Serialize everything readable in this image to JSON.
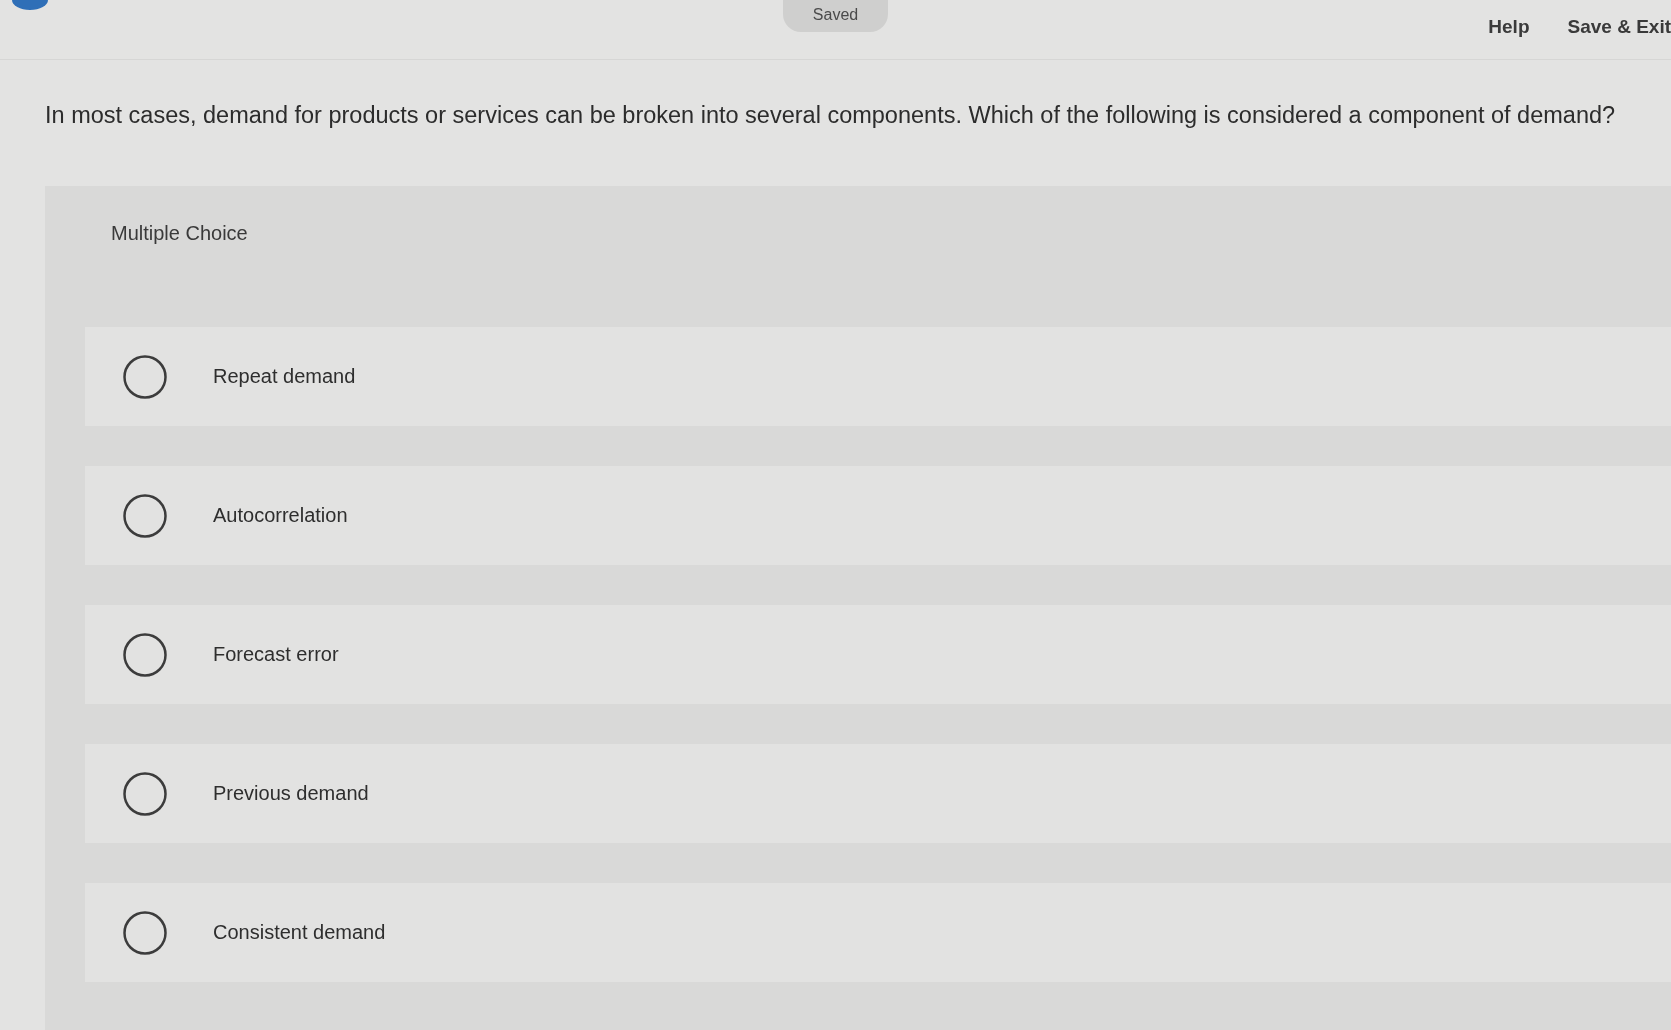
{
  "header": {
    "status": "Saved",
    "links": [
      "Help",
      "Save & Exit"
    ]
  },
  "question": "In most cases, demand for products or services can be broken into several components. Which of the following is considered a component of demand?",
  "answer_panel": {
    "type_label": "Multiple Choice",
    "options": [
      {
        "label": "Repeat demand",
        "selected": false
      },
      {
        "label": "Autocorrelation",
        "selected": false
      },
      {
        "label": "Forecast error",
        "selected": false
      },
      {
        "label": "Previous demand",
        "selected": false
      },
      {
        "label": "Consistent demand",
        "selected": false
      }
    ]
  }
}
